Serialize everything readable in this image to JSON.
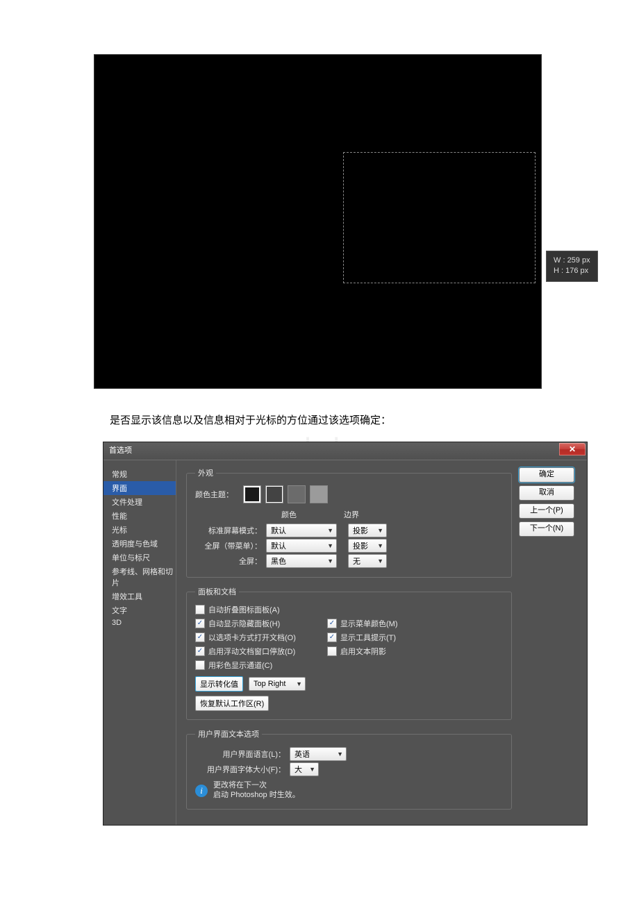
{
  "watermark": "www.bdocx.com",
  "fig1": {
    "tooltip": {
      "w_label": "W :",
      "w_value": "259 px",
      "h_label": "H :",
      "h_value": "176 px"
    }
  },
  "caption": "是否显示该信息以及信息相对于光标的方位通过该选项确定：",
  "dialog": {
    "title": "首选项",
    "close": "✕",
    "buttons": {
      "ok": "确定",
      "cancel": "取消",
      "prev": "上一个(P)",
      "next": "下一个(N)"
    },
    "sidebar": [
      "常规",
      "界面",
      "文件处理",
      "性能",
      "光标",
      "透明度与色域",
      "单位与标尺",
      "参考线、网格和切片",
      "增效工具",
      "文字",
      "3D"
    ],
    "appearance": {
      "legend": "外观",
      "theme_label": "颜色主题：",
      "col_color": "颜色",
      "col_border": "边界",
      "rows": [
        {
          "label": "标准屏幕模式：",
          "color": "默认",
          "border": "投影"
        },
        {
          "label": "全屏（带菜单）：",
          "color": "默认",
          "border": "投影"
        },
        {
          "label": "全屏：",
          "color": "黑色",
          "border": "无"
        }
      ]
    },
    "panels": {
      "legend": "面板和文档",
      "checks": [
        {
          "label": "自动折叠图标面板(A)",
          "checked": false
        },
        {
          "label": "自动显示隐藏面板(H)",
          "checked": true
        },
        {
          "label": "以选项卡方式打开文档(O)",
          "checked": true
        },
        {
          "label": "启用浮动文档窗口停放(D)",
          "checked": true
        },
        {
          "label": "用彩色显示通道(C)",
          "checked": false
        },
        {
          "label": "显示菜单颜色(M)",
          "checked": true
        },
        {
          "label": "显示工具提示(T)",
          "checked": true
        },
        {
          "label": "启用文本阴影",
          "checked": false
        }
      ],
      "transform_label": "显示转化值",
      "transform_value": "Top Right",
      "reset_btn": "恢复默认工作区(R)"
    },
    "uitext": {
      "legend": "用户界面文本选项",
      "lang_label": "用户界面语言(L)：",
      "lang_value": "英语",
      "size_label": "用户界面字体大小(F)：",
      "size_value": "大",
      "info": "更改将在下一次\n启动 Photoshop 时生效。"
    }
  }
}
